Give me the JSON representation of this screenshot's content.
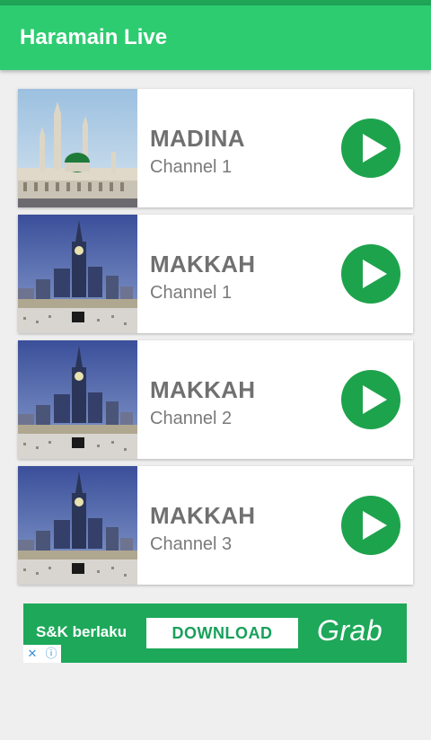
{
  "app": {
    "title": "Haramain Live"
  },
  "channels": [
    {
      "name": "MADINA",
      "subtitle": "Channel 1",
      "thumbnail": "madina-mosque-icon"
    },
    {
      "name": "MAKKAH",
      "subtitle": "Channel 1",
      "thumbnail": "makkah-clock-tower-icon"
    },
    {
      "name": "MAKKAH",
      "subtitle": "Channel 2",
      "thumbnail": "makkah-clock-tower-icon"
    },
    {
      "name": "MAKKAH",
      "subtitle": "Channel 3",
      "thumbnail": "makkah-clock-tower-icon"
    }
  ],
  "ad": {
    "text": "S&K berlaku",
    "button_label": "DOWNLOAD",
    "brand": "Grab",
    "close_glyph": "✕",
    "info_glyph": "ⓘ"
  },
  "colors": {
    "app_bar": "#2ecc71",
    "play_button": "#1ea34d",
    "ad_background": "#1ea85a",
    "background": "#efefef"
  }
}
